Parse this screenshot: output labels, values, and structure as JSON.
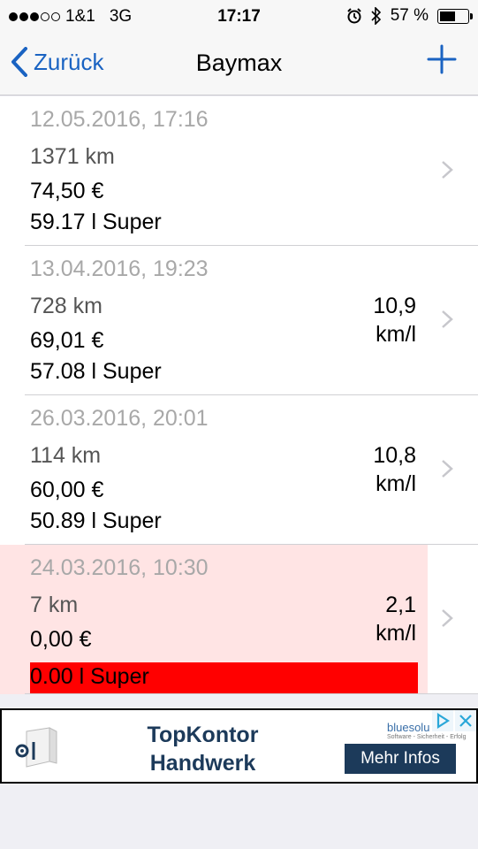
{
  "status": {
    "carrier": "1&1",
    "network": "3G",
    "time": "17:17",
    "battery": "57 %",
    "battery_level": 0.57
  },
  "nav": {
    "back_label": "Zurück",
    "title": "Baymax"
  },
  "entries": [
    {
      "date": "12.05.2016, 17:16",
      "km": "1371 km",
      "price": "74,50 €",
      "fuel": "59.17 l Super",
      "cons_value": "",
      "cons_unit": ""
    },
    {
      "date": "13.04.2016, 19:23",
      "km": "728 km",
      "price": "69,01 €",
      "fuel": "57.08 l Super",
      "cons_value": "10,9",
      "cons_unit": "km/l"
    },
    {
      "date": "26.03.2016, 20:01",
      "km": "114 km",
      "price": "60,00 €",
      "fuel": "50.89 l Super",
      "cons_value": "10,8",
      "cons_unit": "km/l"
    },
    {
      "date": "24.03.2016, 10:30",
      "km": "7 km",
      "price": "0,00 €",
      "fuel": "0.00 l Super",
      "cons_value": "2,1",
      "cons_unit": "km/l"
    }
  ],
  "ad": {
    "title_line1": "TopKontor",
    "title_line2": "Handwerk",
    "brand": "bluesolu",
    "tagline": "Software - Sicherheit - Erfolg",
    "button": "Mehr Infos"
  },
  "colors": {
    "accent": "#1a63c2",
    "warning_row": "#ffe4e4",
    "alert_bar": "#ff0000",
    "ad_dark": "#1c3a5a"
  }
}
